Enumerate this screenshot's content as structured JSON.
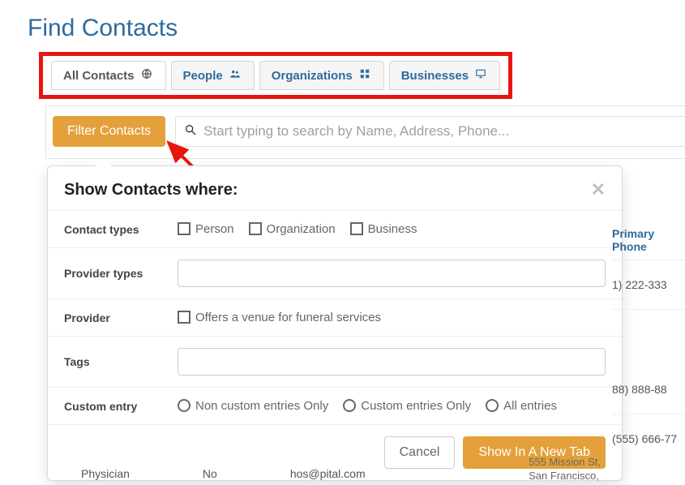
{
  "page": {
    "title": "Find Contacts"
  },
  "tabs": [
    {
      "label": "All Contacts",
      "icon": "globe",
      "active": true
    },
    {
      "label": "People",
      "icon": "users",
      "active": false
    },
    {
      "label": "Organizations",
      "icon": "grid",
      "active": false
    },
    {
      "label": "Businesses",
      "icon": "monitor",
      "active": false
    }
  ],
  "filter_button": "Filter Contacts",
  "search": {
    "placeholder": "Start typing to search by Name, Address, Phone..."
  },
  "popover": {
    "title": "Show Contacts where:",
    "rows": {
      "contact_types": {
        "label": "Contact types",
        "options": [
          "Person",
          "Organization",
          "Business"
        ]
      },
      "provider_types": {
        "label": "Provider types"
      },
      "provider": {
        "label": "Provider",
        "option": "Offers a venue for funeral services"
      },
      "tags": {
        "label": "Tags"
      },
      "custom_entry": {
        "label": "Custom entry",
        "options": [
          "Non custom entries Only",
          "Custom entries Only",
          "All entries"
        ]
      }
    },
    "buttons": {
      "cancel": "Cancel",
      "show": "Show In A New Tab"
    }
  },
  "table_partial": {
    "header": "Primary Phone",
    "rows": [
      "1) 222-333",
      "88) 888-88",
      "(555) 666-77"
    ],
    "bottom": {
      "col1": "Physician",
      "col2": "No",
      "col3": "hos@pital.com",
      "addr_line1": "555 Mission St,",
      "addr_line2": "San Francisco,"
    }
  }
}
